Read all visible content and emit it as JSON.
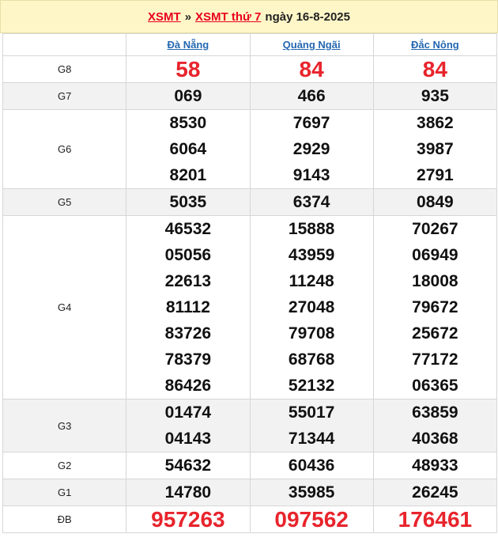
{
  "header": {
    "link1": "XSMT",
    "separator": "»",
    "link2": "XSMT thứ 7",
    "date_text": "ngày 16-8-2025"
  },
  "columns": [
    "Đà Nẵng",
    "Quảng Ngãi",
    "Đắc Nông"
  ],
  "rows": [
    {
      "label": "G8",
      "values": [
        [
          "58"
        ],
        [
          "84"
        ],
        [
          "84"
        ]
      ]
    },
    {
      "label": "G7",
      "values": [
        [
          "069"
        ],
        [
          "466"
        ],
        [
          "935"
        ]
      ]
    },
    {
      "label": "G6",
      "values": [
        [
          "8530",
          "6064",
          "8201"
        ],
        [
          "7697",
          "2929",
          "9143"
        ],
        [
          "3862",
          "3987",
          "2791"
        ]
      ]
    },
    {
      "label": "G5",
      "values": [
        [
          "5035"
        ],
        [
          "6374"
        ],
        [
          "0849"
        ]
      ]
    },
    {
      "label": "G4",
      "values": [
        [
          "46532",
          "05056",
          "22613",
          "81112",
          "83726",
          "78379",
          "86426"
        ],
        [
          "15888",
          "43959",
          "11248",
          "27048",
          "79708",
          "68768",
          "52132"
        ],
        [
          "70267",
          "06949",
          "18008",
          "79672",
          "25672",
          "77172",
          "06365"
        ]
      ]
    },
    {
      "label": "G3",
      "values": [
        [
          "01474",
          "04143"
        ],
        [
          "55017",
          "71344"
        ],
        [
          "63859",
          "40368"
        ]
      ]
    },
    {
      "label": "G2",
      "values": [
        [
          "54632"
        ],
        [
          "60436"
        ],
        [
          "48933"
        ]
      ]
    },
    {
      "label": "G1",
      "values": [
        [
          "14780"
        ],
        [
          "35985"
        ],
        [
          "26245"
        ]
      ]
    },
    {
      "label": "ĐB",
      "values": [
        [
          "957263"
        ],
        [
          "097562"
        ],
        [
          "176461"
        ]
      ]
    }
  ],
  "colors": {
    "prize_red": "#e8242c",
    "header_bg": "#fff6c8",
    "link_blue": "#2467b0"
  }
}
